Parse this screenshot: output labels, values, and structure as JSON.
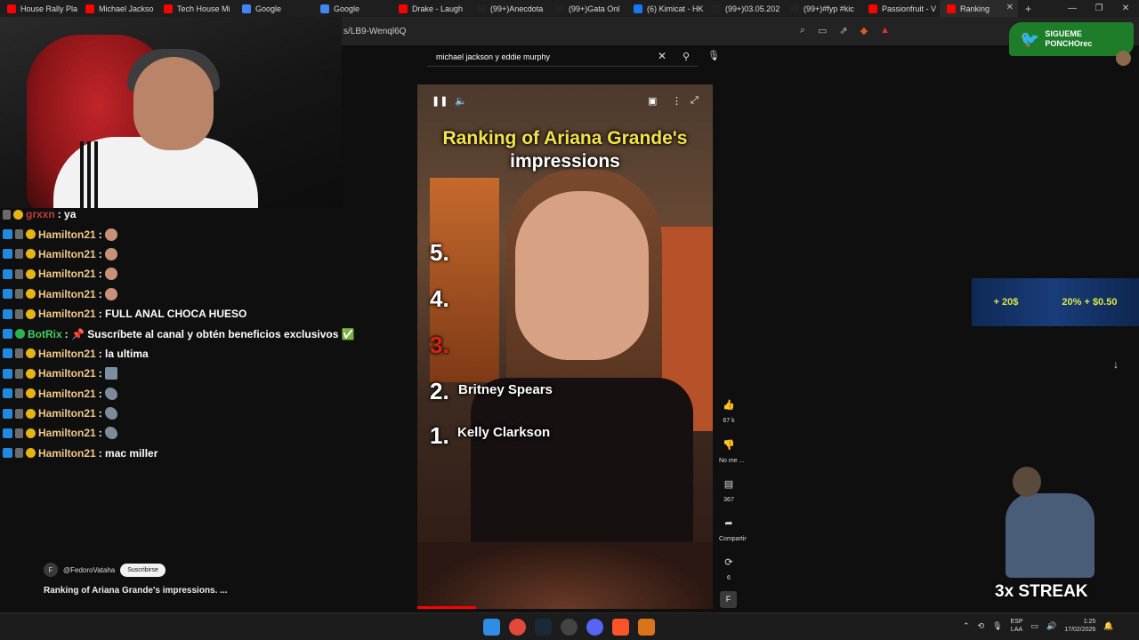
{
  "browser": {
    "tabs": [
      {
        "label": "House Rally Pla",
        "fav_color": "#ff0000"
      },
      {
        "label": "Michael Jackso",
        "fav_color": "#ff0000"
      },
      {
        "label": "Tech House Mi",
        "fav_color": "#ff0000"
      },
      {
        "label": "Google",
        "fav_color": "#4285f4"
      },
      {
        "label": "Google",
        "fav_color": "#4285f4"
      },
      {
        "label": "Drake - Laugh",
        "fav_color": "#ff0000"
      },
      {
        "label": "(99+)Anecdota",
        "fav_color": "#222222"
      },
      {
        "label": "(99+)Gata Onl",
        "fav_color": "#222222"
      },
      {
        "label": "(6) Kimicat - HK",
        "fav_color": "#1877f2"
      },
      {
        "label": "(99+)03.05.202",
        "fav_color": "#222222"
      },
      {
        "label": "(99+)#fyp #kic",
        "fav_color": "#222222"
      },
      {
        "label": "Passionfruit - V",
        "fav_color": "#ff0000"
      },
      {
        "label": "Ranking",
        "fav_color": "#ff0000"
      }
    ],
    "active_tab_index": 12,
    "new_tab": "+",
    "url": "s/LB9-Wenql6Q"
  },
  "chat": [
    {
      "user": "grxxn",
      "text": ": ya",
      "color": "red",
      "emote": ""
    },
    {
      "user": "Hamilton21",
      "text": " :",
      "color": "gold",
      "emote": "face"
    },
    {
      "user": "Hamilton21",
      "text": " :",
      "color": "gold",
      "emote": "face"
    },
    {
      "user": "Hamilton21",
      "text": " :",
      "color": "gold",
      "emote": "face"
    },
    {
      "user": "Hamilton21",
      "text": " :",
      "color": "gold",
      "emote": "face"
    },
    {
      "user": "Hamilton21",
      "text": " : FULL ANAL CHOCA HUESO",
      "color": "gold",
      "emote": ""
    },
    {
      "user": "BotRix",
      "text": " : 📌 Suscríbete al canal y obtén beneficios exclusivos ✅",
      "color": "green",
      "emote": ""
    },
    {
      "user": "Hamilton21",
      "text": " : la ultima",
      "color": "gold",
      "emote": ""
    },
    {
      "user": "Hamilton21",
      "text": " :",
      "color": "gold",
      "emote": "img"
    },
    {
      "user": "Hamilton21",
      "text": " :",
      "color": "gold",
      "emote": "bird"
    },
    {
      "user": "Hamilton21",
      "text": " :",
      "color": "gold",
      "emote": "bird"
    },
    {
      "user": "Hamilton21",
      "text": " :",
      "color": "gold",
      "emote": "bird"
    },
    {
      "user": "Hamilton21",
      "text": " : mac miller",
      "color": "gold",
      "emote": ""
    }
  ],
  "youtube": {
    "search_query": "michael jackson y eddie murphy",
    "channel_initial": "F",
    "channel_handle": "@FedoroVataha",
    "subscribe_label": "Suscribirse",
    "short_title": "Ranking of Ariana Grande's impressions. ...",
    "video": {
      "title_line1": "Ranking of Ariana Grande's",
      "title_line2": "impressions",
      "ranks": [
        {
          "num": "5.",
          "name": ""
        },
        {
          "num": "4.",
          "name": ""
        },
        {
          "num": "3.",
          "name": ""
        },
        {
          "num": "2.",
          "name": "Britney Spears"
        },
        {
          "num": "1.",
          "name": "Kelly Clarkson"
        }
      ],
      "progress_fraction": 0.2
    },
    "actions": {
      "likes": "67 k",
      "dislike": "No me ...",
      "comments": "367",
      "share": "Compartir",
      "remix": "6",
      "channel_badge": "F"
    }
  },
  "overlays": {
    "twitter_line1": "SIGUEME",
    "twitter_line2": "PONCHOrec",
    "banner_left": "+ 20$",
    "banner_right": "20% + $0.50",
    "streak": "3x STREAK"
  },
  "taskbar": {
    "lang_line1": "ESP",
    "lang_line2": "LAA",
    "time": "1:25",
    "date": "17/02/2026"
  }
}
